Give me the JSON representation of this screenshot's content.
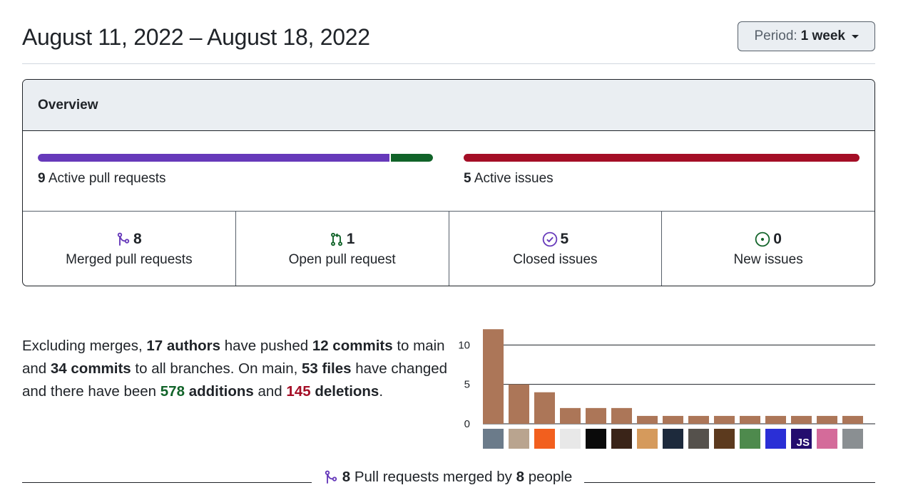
{
  "header": {
    "date_range": "August 11, 2022 – August 18, 2022",
    "period_label": "Period:",
    "period_value": "1 week"
  },
  "overview": {
    "title": "Overview",
    "pull_requests": {
      "count": "9",
      "label": "Active pull requests",
      "merged_fraction": 0.889
    },
    "issues": {
      "count": "5",
      "label": "Active issues"
    },
    "stats": [
      {
        "icon": "git-merge-icon",
        "value": "8",
        "label": "Merged pull requests",
        "color": "#6639ba"
      },
      {
        "icon": "git-pull-request-icon",
        "value": "1",
        "label": "Open pull request",
        "color": "#116329"
      },
      {
        "icon": "issue-closed-icon",
        "value": "5",
        "label": "Closed issues",
        "color": "#6639ba"
      },
      {
        "icon": "issue-opened-icon",
        "value": "0",
        "label": "New issues",
        "color": "#116329"
      }
    ]
  },
  "summary": {
    "t1": "Excluding merges, ",
    "authors": "17 authors",
    "t2": " have pushed ",
    "commits_main": "12 commits",
    "t3": " to main and ",
    "commits_all": "34 commits",
    "t4": " to all branches. On main, ",
    "files": "53 files",
    "t5": " have changed and there have been ",
    "additions": "578",
    "additions_label": "additions",
    "t6": " and ",
    "deletions": "145",
    "deletions_label": "deletions",
    "t7": "."
  },
  "chart_data": {
    "type": "bar",
    "values": [
      12,
      5,
      4,
      2,
      2,
      2,
      1,
      1,
      1,
      1,
      1,
      1,
      1,
      1,
      1
    ],
    "yticks": [
      0,
      5,
      10
    ],
    "ylim": [
      0,
      12.2
    ],
    "bar_color": "#ac7658",
    "avatar_colors": [
      "#6b7b8a",
      "#b9a48f",
      "#f25f1e",
      "#e8e8e8",
      "#0a0a0a",
      "#3a2418",
      "#d59a5c",
      "#1d2a3c",
      "#55514c",
      "#5c3a1e",
      "#4e8a4d",
      "#2a2fd6",
      "#240d6e",
      "#d46b9a",
      "#8a8f92"
    ],
    "avatar_badge": {
      "index": 12,
      "text": "JS"
    }
  },
  "footer": {
    "count": "8",
    "text1": " Pull requests merged by ",
    "people": "8",
    "text2": " people"
  }
}
